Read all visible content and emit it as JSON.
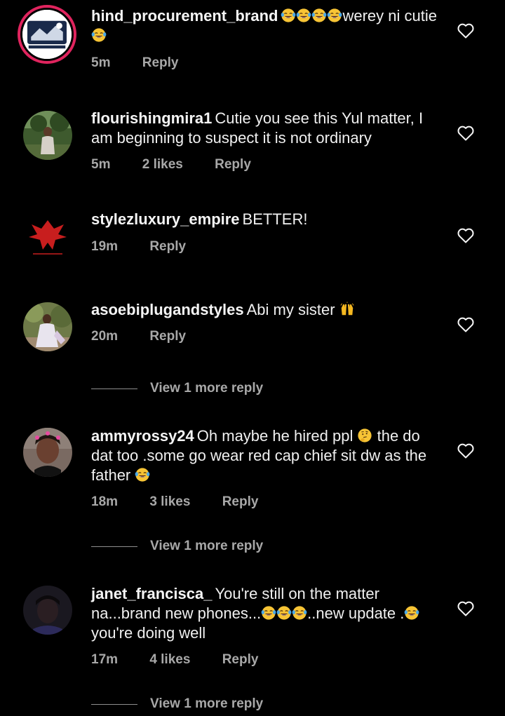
{
  "colors": {
    "background": "#000000",
    "text": "#f0f0f0",
    "meta": "#a8a8a8",
    "story_ring": "#e0245e"
  },
  "comments": [
    {
      "username": "hind_procurement_brand",
      "segments": [
        {
          "emoji": "face-with-tears-of-joy"
        },
        {
          "emoji": "face-with-tears-of-joy"
        },
        {
          "emoji": "face-with-tears-of-joy"
        },
        {
          "emoji": "face-with-tears-of-joy"
        },
        {
          "text": "werey ni cutie"
        },
        {
          "emoji": "face-with-tears-of-joy"
        }
      ],
      "time": "5m",
      "likes": "",
      "reply_label": "Reply",
      "avatar": "brand-logo-avatar"
    },
    {
      "username": "flourishingmira1",
      "segments": [
        {
          "text": "Cutie you see this Yul matter, I am beginning to suspect it is not ordinary"
        }
      ],
      "time": "5m",
      "likes": "2 likes",
      "reply_label": "Reply",
      "avatar": "photo-avatar-outdoor"
    },
    {
      "username": "stylezluxury_empire",
      "segments": [
        {
          "text": "BETTER!"
        }
      ],
      "time": "19m",
      "likes": "",
      "reply_label": "Reply",
      "avatar": "eagle-logo-avatar"
    },
    {
      "username": "asoebiplugandstyles",
      "segments": [
        {
          "text": "Abi my sister "
        },
        {
          "emoji": "raising-hands"
        }
      ],
      "time": "20m",
      "likes": "",
      "reply_label": "Reply",
      "avatar": "photo-avatar-dress",
      "view_more": "View 1 more reply"
    },
    {
      "username": "ammyrossy24",
      "segments": [
        {
          "text": "Oh maybe he hired  ppl "
        },
        {
          "emoji": "thinking-face"
        },
        {
          "text": "  the do dat too .some go wear red cap chief  sit dw as the father "
        },
        {
          "emoji": "face-with-tears-of-joy"
        }
      ],
      "time": "18m",
      "likes": "3 likes",
      "reply_label": "Reply",
      "avatar": "photo-avatar-selfie",
      "view_more": "View 1 more reply"
    },
    {
      "username": "janet_francisca_",
      "segments": [
        {
          "text": "You're still on the matter na...brand new phones..."
        },
        {
          "emoji": "face-with-tears-of-joy"
        },
        {
          "emoji": "face-with-tears-of-joy"
        },
        {
          "emoji": "face-with-tears-of-joy"
        },
        {
          "text": "..new update ."
        },
        {
          "emoji": "face-with-tears-of-joy"
        },
        {
          "text": "you're doing well"
        }
      ],
      "time": "17m",
      "likes": "4 likes",
      "reply_label": "Reply",
      "avatar": "photo-avatar-dark",
      "view_more": "View 1 more reply"
    }
  ]
}
